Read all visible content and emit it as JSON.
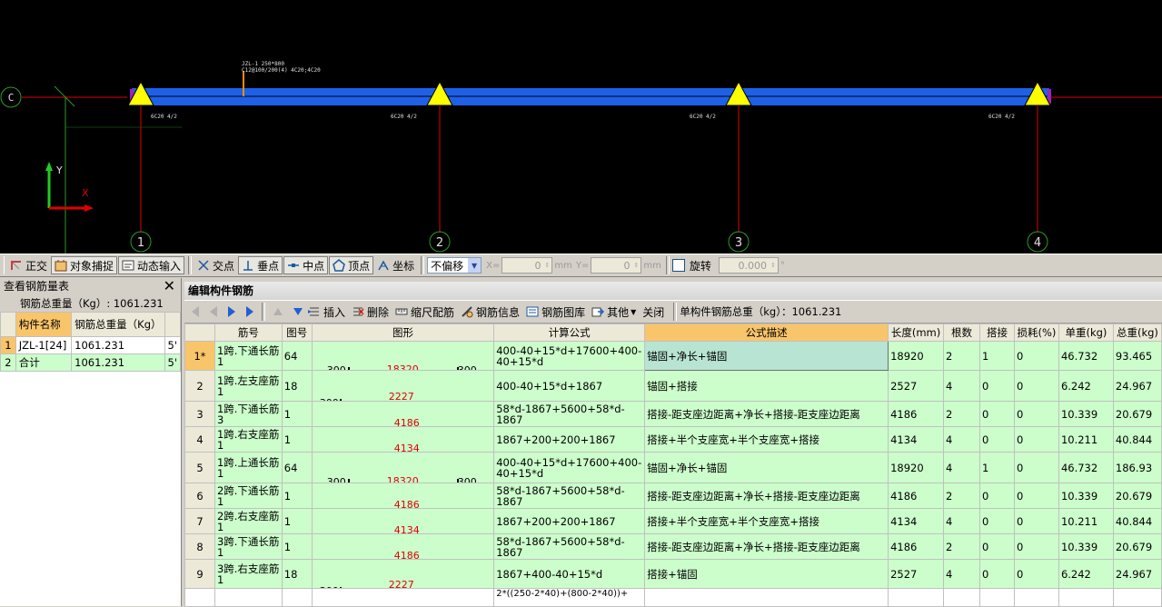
{
  "cad": {
    "axis_c": "C",
    "axis_nums": [
      "1",
      "2",
      "3",
      "4"
    ],
    "beam_label_1": "JZL-1 250*800",
    "beam_label_2": "C12@100/200(4) 4C20;4C20",
    "bottom_bar_labels": [
      "6C20 4/2",
      "6C20 4/2",
      "6C20 4/2",
      "6C20 4/2"
    ],
    "y_axis": "Y",
    "x_axis": "X"
  },
  "snapbar": {
    "ortho": "正交",
    "osnap": "对象捕捉",
    "dyn_input": "动态输入",
    "intersect": "交点",
    "perp": "垂点",
    "mid": "中点",
    "vertex": "顶点",
    "coord": "坐标",
    "offset_mode": "不偏移",
    "x_label": "X=",
    "x_value": "0",
    "y_label": "Y=",
    "y_value": "0",
    "unit_mm": "mm",
    "rotate": "旋转",
    "rotate_value": "0.000",
    "degree": "°"
  },
  "left": {
    "title": "查看钢筋量表",
    "total_label": "钢筋总重量（Kg）: 1061.231",
    "col_name": "构件名称",
    "col_weight": "钢筋总重量（Kg）",
    "col_extra": "5'",
    "rows": [
      {
        "n": "1",
        "name": "JZL-1[24]",
        "weight": "1061.231",
        "extra": "5'"
      },
      {
        "n": "2",
        "name": "合计",
        "weight": "1061.231",
        "extra": "5'"
      }
    ]
  },
  "right": {
    "title": "编辑构件钢筋",
    "insert": "插入",
    "delete": "删除",
    "scale": "缩尺配筋",
    "info": "钢筋信息",
    "library": "钢筋图库",
    "other": "其他",
    "close": "关闭",
    "total": "单构件钢筋总重（kg）：1061.231",
    "headers": [
      "筋号",
      "图号",
      "图形",
      "计算公式",
      "公式描述",
      "长度(mm)",
      "根数",
      "搭接",
      "损耗(%)",
      "单重(kg)",
      "总重(kg)"
    ],
    "rows": [
      {
        "n": "1*",
        "name": "1跨.下通长筋1",
        "fig": "64",
        "left": "300",
        "len": "18320",
        "right": "300",
        "formula": "400-40+15*d+17600+400-40+15*d",
        "desc": "锚固+净长+锚固",
        "length": "18920",
        "count": "2",
        "lap": "1",
        "loss": "0",
        "unit": "46.732",
        "total": "93.465"
      },
      {
        "n": "2",
        "name": "1跨.左支座筋1",
        "fig": "18",
        "left": "300",
        "len": "2227",
        "right": "",
        "formula": "400-40+15*d+1867",
        "desc": "锚固+搭接",
        "length": "2527",
        "count": "4",
        "lap": "0",
        "loss": "0",
        "unit": "6.242",
        "total": "24.967"
      },
      {
        "n": "3",
        "name": "1跨.下通长筋3",
        "fig": "1",
        "left": "",
        "len": "4186",
        "right": "",
        "formula": "58*d-1867+5600+58*d-1867",
        "desc": "搭接-距支座边距离+净长+搭接-距支座边距离",
        "length": "4186",
        "count": "2",
        "lap": "0",
        "loss": "0",
        "unit": "10.339",
        "total": "20.679"
      },
      {
        "n": "4",
        "name": "1跨.右支座筋1",
        "fig": "1",
        "left": "",
        "len": "4134",
        "right": "",
        "formula": "1867+200+200+1867",
        "desc": "搭接+半个支座宽+半个支座宽+搭接",
        "length": "4134",
        "count": "4",
        "lap": "0",
        "loss": "0",
        "unit": "10.211",
        "total": "40.844"
      },
      {
        "n": "5",
        "name": "1跨.上通长筋1",
        "fig": "64",
        "left": "300",
        "len": "18320",
        "right": "300",
        "formula": "400-40+15*d+17600+400-40+15*d",
        "desc": "锚固+净长+锚固",
        "length": "18920",
        "count": "4",
        "lap": "1",
        "loss": "0",
        "unit": "46.732",
        "total": "186.93"
      },
      {
        "n": "6",
        "name": "2跨.下通长筋1",
        "fig": "1",
        "left": "",
        "len": "4186",
        "right": "",
        "formula": "58*d-1867+5600+58*d-1867",
        "desc": "搭接-距支座边距离+净长+搭接-距支座边距离",
        "length": "4186",
        "count": "2",
        "lap": "0",
        "loss": "0",
        "unit": "10.339",
        "total": "20.679"
      },
      {
        "n": "7",
        "name": "2跨.右支座筋1",
        "fig": "1",
        "left": "",
        "len": "4134",
        "right": "",
        "formula": "1867+200+200+1867",
        "desc": "搭接+半个支座宽+半个支座宽+搭接",
        "length": "4134",
        "count": "4",
        "lap": "0",
        "loss": "0",
        "unit": "10.211",
        "total": "40.844"
      },
      {
        "n": "8",
        "name": "3跨.下通长筋1",
        "fig": "1",
        "left": "",
        "len": "4186",
        "right": "",
        "formula": "58*d-1867+5600+58*d-1867",
        "desc": "搭接-距支座边距离+净长+搭接-距支座边距离",
        "length": "4186",
        "count": "2",
        "lap": "0",
        "loss": "0",
        "unit": "10.339",
        "total": "20.679"
      },
      {
        "n": "9",
        "name": "3跨.右支座筋1",
        "fig": "18",
        "left": "300",
        "len": "2227",
        "right": "",
        "formula": "1867+400-40+15*d",
        "desc": "搭接+锚固",
        "length": "2527",
        "count": "4",
        "lap": "0",
        "loss": "0",
        "unit": "6.242",
        "total": "24.967"
      }
    ],
    "partial_formula": "2*((250-2*40)+(800-2*40))+"
  }
}
